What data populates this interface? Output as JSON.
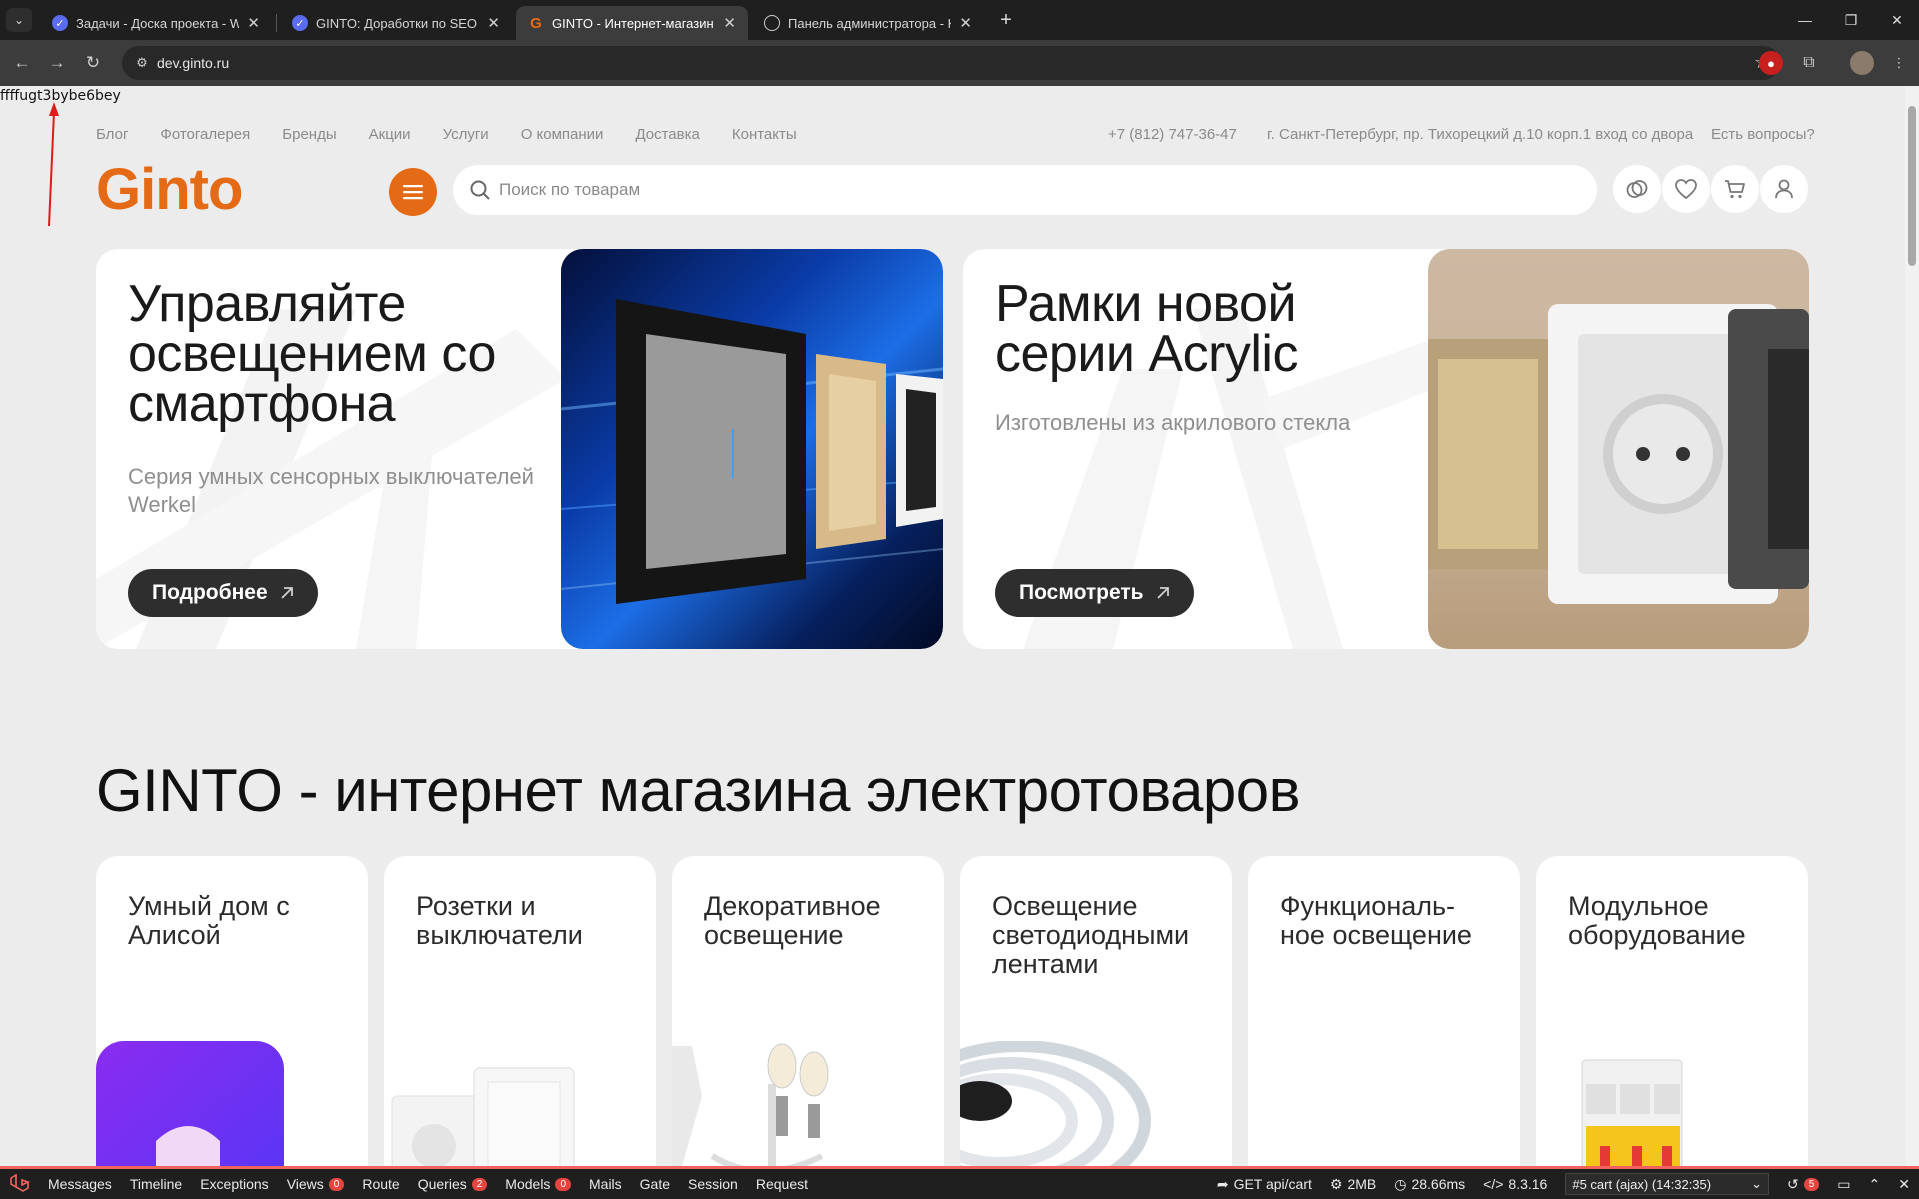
{
  "browser": {
    "tabs": [
      {
        "title": "Задачи - Доска проекта - WEB",
        "active": false
      },
      {
        "title": "GINTO: Доработки по SEO (фр",
        "active": false
      },
      {
        "title": "GINTO - Интернет-магазин эле",
        "active": true
      },
      {
        "title": "Панель администратора - Kav",
        "active": false
      }
    ],
    "url": "dev.ginto.ru"
  },
  "debug_text": "ffffugt3bybe6bey",
  "topnav": {
    "links": [
      "Блог",
      "Фотогалерея",
      "Бренды",
      "Акции",
      "Услуги",
      "О компании",
      "Доставка",
      "Контакты"
    ],
    "phone": "+7 (812) 747-36-47",
    "address": "г. Санкт-Петербург, пр. Тихорецкий д.10 корп.1 вход со двора",
    "questions": "Есть вопросы?"
  },
  "header": {
    "logo": "Ginto",
    "search_placeholder": "Поиск по товарам"
  },
  "banners": [
    {
      "title_lines": [
        "Управляйте",
        "освещением со",
        "смартфона"
      ],
      "subtitle_lines": [
        "Серия умных сенсорных выключателей",
        "Werkel"
      ],
      "button": "Подробнее"
    },
    {
      "title_lines": [
        "Рамки новой",
        "серии Acrylic"
      ],
      "subtitle_lines": [
        "Изготовлены из акрилового стекла"
      ],
      "button": "Посмотреть"
    }
  ],
  "main_heading": "GINTO - интернет магазина электротоваров",
  "categories": [
    {
      "title_lines": [
        "Умный дом с",
        "Алисой"
      ]
    },
    {
      "title_lines": [
        "Розетки и",
        "выключатели"
      ]
    },
    {
      "title_lines": [
        "Декоративное",
        "освещение"
      ]
    },
    {
      "title_lines": [
        "Освещение",
        "светодиодными",
        "лентами"
      ]
    },
    {
      "title_lines": [
        "Функциональ-",
        "ное освещение"
      ]
    },
    {
      "title_lines": [
        "Модульное",
        "оборудование"
      ]
    }
  ],
  "debugbar": {
    "items": [
      {
        "label": "Messages"
      },
      {
        "label": "Timeline"
      },
      {
        "label": "Exceptions"
      },
      {
        "label": "Views",
        "badge": "0"
      },
      {
        "label": "Route"
      },
      {
        "label": "Queries",
        "badge": "2"
      },
      {
        "label": "Models",
        "badge": "0"
      },
      {
        "label": "Mails"
      },
      {
        "label": "Gate"
      },
      {
        "label": "Session"
      },
      {
        "label": "Request"
      }
    ],
    "request": "GET api/cart",
    "memory": "2MB",
    "time": "28.66ms",
    "php": "8.3.16",
    "select": "#5 cart (ajax) (14:32:35)",
    "history_badge": "5"
  },
  "colors": {
    "accent": "#e56a15",
    "debug_red": "#f4645f"
  }
}
